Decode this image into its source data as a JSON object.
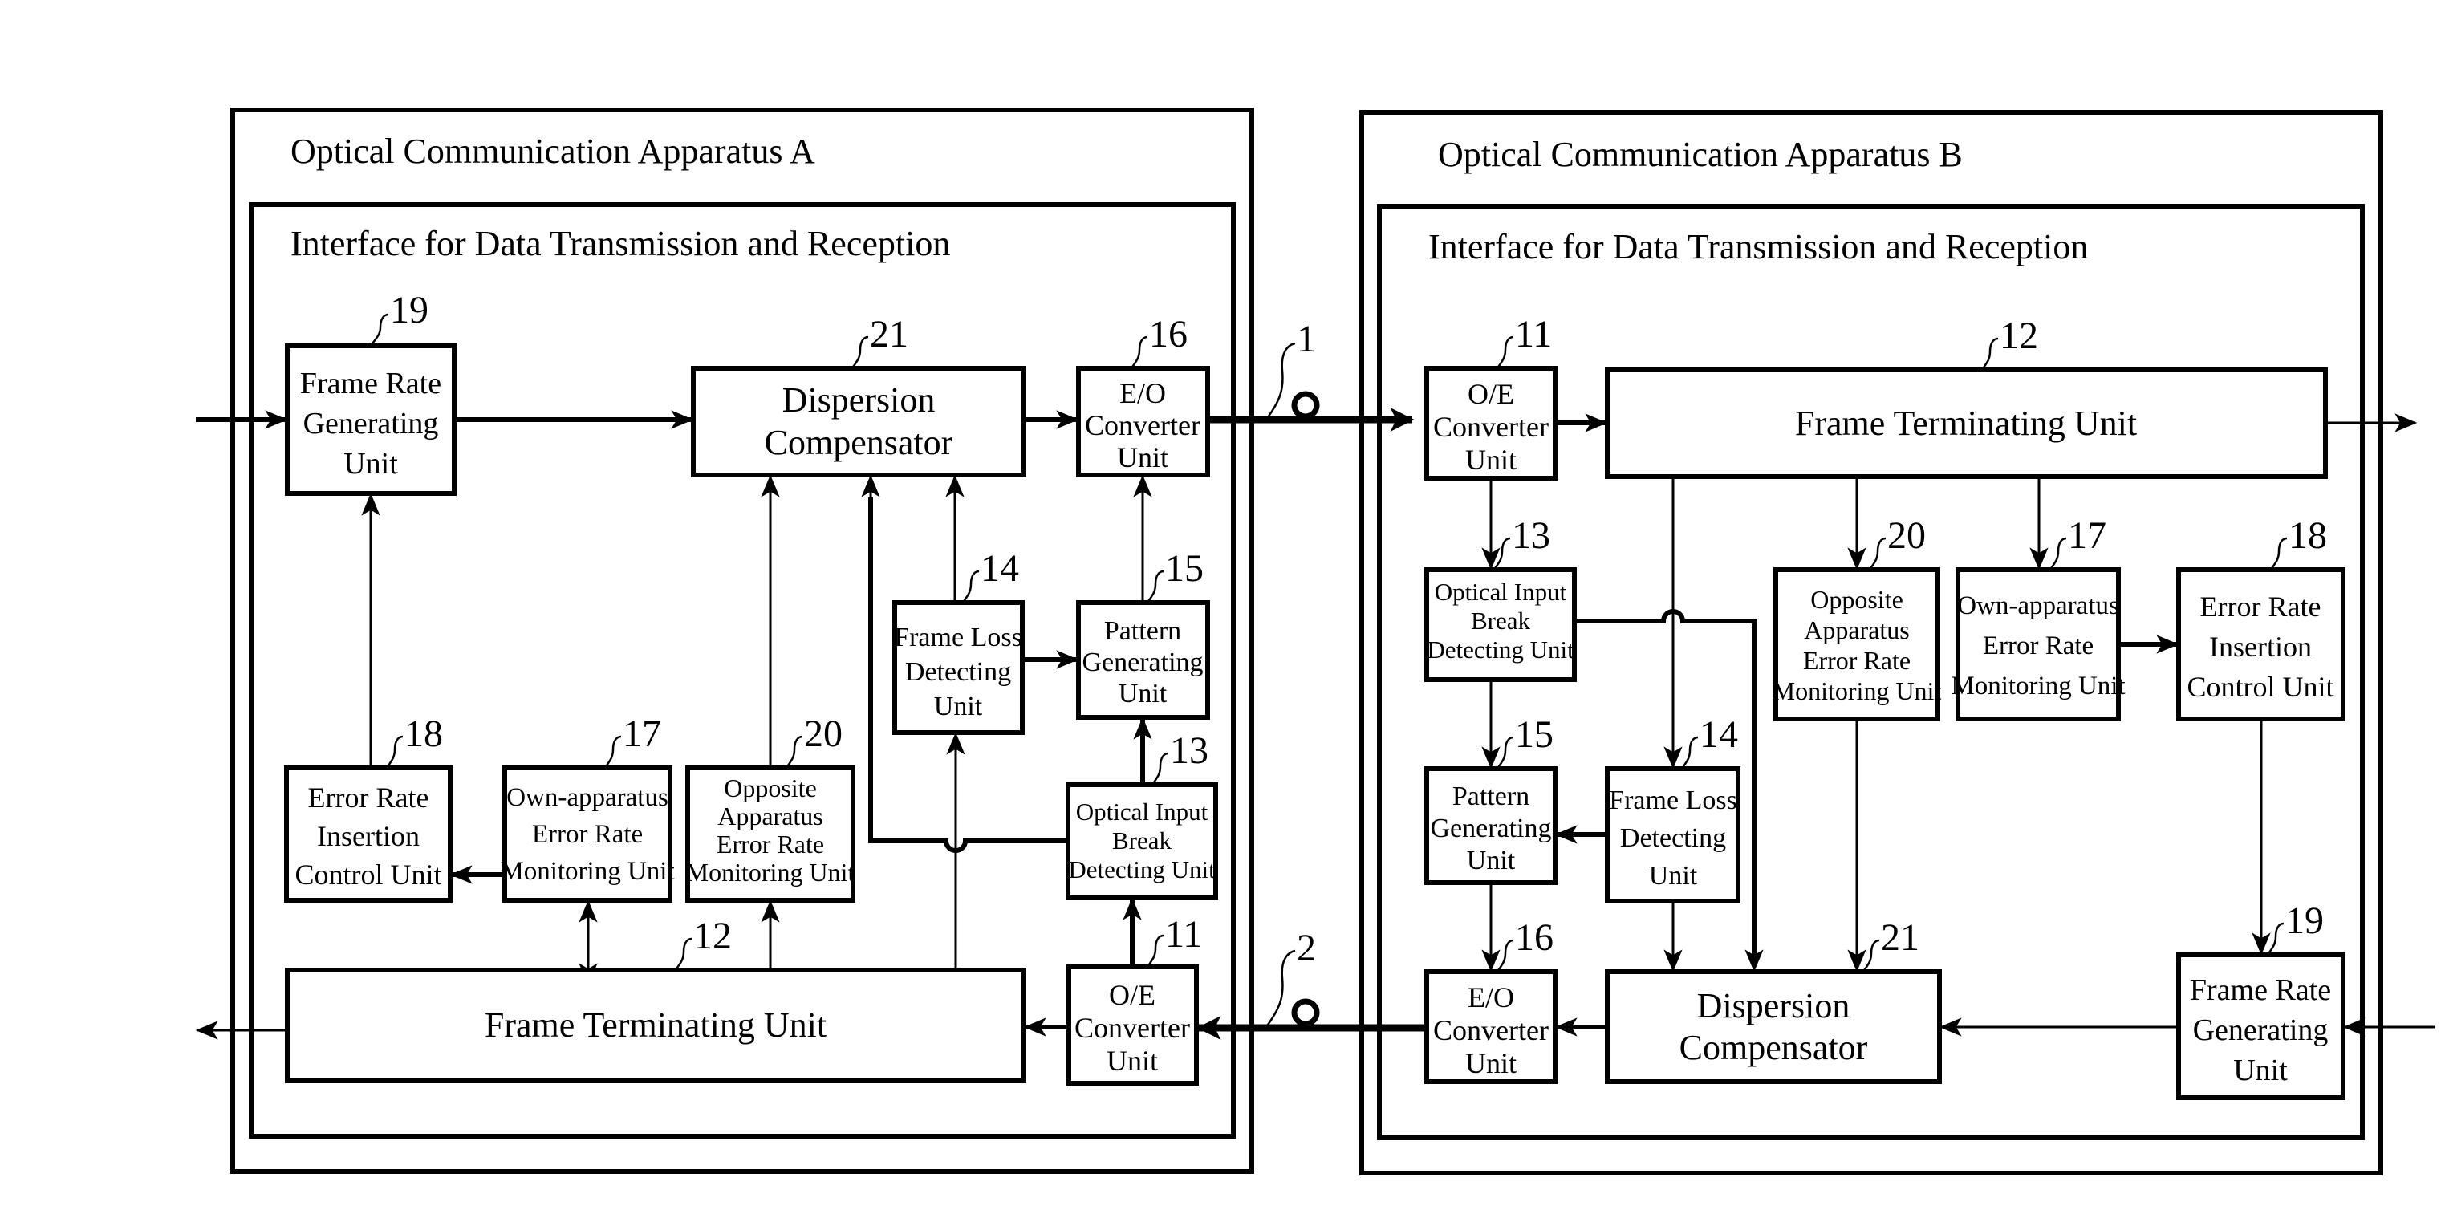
{
  "figure": {
    "apparatus_a": {
      "title": "Optical Communication Apparatus A",
      "interface_title": "Interface for Data Transmission and Reception",
      "blocks": {
        "frame_rate_generating_unit": {
          "ref": "19",
          "lines": [
            "Frame Rate",
            "Generating",
            "Unit"
          ]
        },
        "dispersion_compensator": {
          "ref": "21",
          "lines": [
            "Dispersion",
            "Compensator"
          ]
        },
        "eo_converter_unit": {
          "ref": "16",
          "lines": [
            "E/O",
            "Converter",
            "Unit"
          ]
        },
        "frame_loss_detecting_unit": {
          "ref": "14",
          "lines": [
            "Frame Loss",
            "Detecting",
            "Unit"
          ]
        },
        "pattern_generating_unit": {
          "ref": "15",
          "lines": [
            "Pattern",
            "Generating",
            "Unit"
          ]
        },
        "optical_input_break_detecting_unit": {
          "ref": "13",
          "lines": [
            "Optical Input",
            "Break",
            "Detecting Unit"
          ]
        },
        "error_rate_insertion_control_unit": {
          "ref": "18",
          "lines": [
            "Error Rate",
            "Insertion",
            "Control Unit"
          ]
        },
        "own_apparatus_error_rate_monitoring_unit": {
          "ref": "17",
          "lines": [
            "Own-apparatus",
            "Error Rate",
            "Monitoring Unit"
          ]
        },
        "opposite_apparatus_error_rate_monitoring_unit": {
          "ref": "20",
          "lines": [
            "Opposite",
            "Apparatus",
            "Error Rate",
            "Monitoring Unit"
          ]
        },
        "frame_terminating_unit": {
          "ref": "12",
          "lines": [
            "Frame Terminating Unit"
          ]
        },
        "oe_converter_unit": {
          "ref": "11",
          "lines": [
            "O/E",
            "Converter",
            "Unit"
          ]
        }
      }
    },
    "apparatus_b": {
      "title": "Optical Communication Apparatus B",
      "interface_title": "Interface for Data Transmission and Reception",
      "blocks": {
        "oe_converter_unit": {
          "ref": "11",
          "lines": [
            "O/E",
            "Converter",
            "Unit"
          ]
        },
        "frame_terminating_unit": {
          "ref": "12",
          "lines": [
            "Frame Terminating Unit"
          ]
        },
        "optical_input_break_detecting_unit": {
          "ref": "13",
          "lines": [
            "Optical Input",
            "Break",
            "Detecting Unit"
          ]
        },
        "opposite_apparatus_error_rate_monitoring_unit": {
          "ref": "20",
          "lines": [
            "Opposite",
            "Apparatus",
            "Error Rate",
            "Monitoring Unit"
          ]
        },
        "own_apparatus_error_rate_monitoring_unit": {
          "ref": "17",
          "lines": [
            "Own-apparatus",
            "Error Rate",
            "Monitoring Unit"
          ]
        },
        "error_rate_insertion_control_unit": {
          "ref": "18",
          "lines": [
            "Error Rate",
            "Insertion",
            "Control Unit"
          ]
        },
        "pattern_generating_unit": {
          "ref": "15",
          "lines": [
            "Pattern",
            "Generating",
            "Unit"
          ]
        },
        "frame_loss_detecting_unit": {
          "ref": "14",
          "lines": [
            "Frame Loss",
            "Detecting",
            "Unit"
          ]
        },
        "eo_converter_unit": {
          "ref": "16",
          "lines": [
            "E/O",
            "Converter",
            "Unit"
          ]
        },
        "dispersion_compensator": {
          "ref": "21",
          "lines": [
            "Dispersion",
            "Compensator"
          ]
        },
        "frame_rate_generating_unit": {
          "ref": "19",
          "lines": [
            "Frame Rate",
            "Generating",
            "Unit"
          ]
        }
      }
    },
    "fibers": {
      "upper": {
        "ref": "1"
      },
      "lower": {
        "ref": "2"
      }
    }
  }
}
